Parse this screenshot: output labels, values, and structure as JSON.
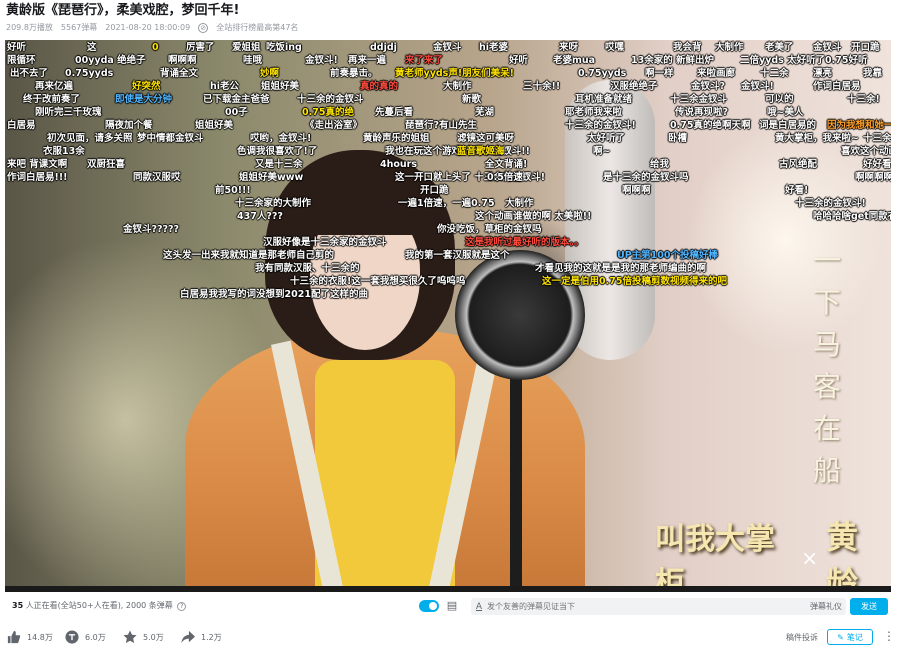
{
  "video": {
    "title": "黄龄版《琵琶行》，柔美戏腔，梦回千年!",
    "views": "209.8万播放",
    "danmaku_count": "5567弹幕",
    "date": "2021-08-20 18:00:09",
    "rank": "全站排行榜最高第47名"
  },
  "player": {
    "overlay_vertical_text": "一下马客在船",
    "logo_left": "叫我大掌柜",
    "logo_x": "×",
    "logo_right": "黄龄"
  },
  "danmaku": [
    "好听",
    "这",
    "0",
    "厉害了",
    "爱姐姐",
    "吃饭ing",
    "ddjdj",
    "金钗斗",
    "hi老婆",
    "来呀",
    "哎嘿",
    "我会背",
    "大制作",
    "老美了",
    "金钗斗",
    "开口跪",
    "限循环",
    "00yyda 绝绝子",
    "啊啊啊",
    "哇哦",
    "金钗斗!",
    "再来一遍",
    "来了来了",
    "好听",
    "老婆mua",
    "13余家的 新鲜出炉",
    "二倍yyds 太好听了",
    "0.75好听",
    "出不去了",
    "0.75yyds",
    "背诵全文",
    "妙啊",
    "前奏暴击。",
    "黄老师yyds声!朋友们美呆!",
    "0.75yyds",
    "啊一样",
    "来啦画廊",
    "十二余",
    "漂亮",
    "我靠",
    "再来亿遍",
    "好突然",
    "hi老公",
    "姐姐好美",
    "真的真的",
    "大制作",
    "三十余!!",
    "汉服绝绝子",
    "金钗斗?",
    "金钗斗!",
    "作词白居易",
    "终于改前奏了",
    "即使是大分钟",
    "已下载金主爸爸",
    "十三余的金钗斗",
    "新歌",
    "耳机准备就绪",
    "十三余金钗斗",
    "可以的",
    "十三余!",
    "刚听完三千玫瑰",
    "00子",
    "0.75真的绝",
    "先蔓后看",
    "芜湖",
    "耶老师我来啦",
    "传说再现啦?",
    "哦~美人",
    "白居易",
    "隔夜加个餐",
    "姐姐好美",
    "《走出浴室》",
    "琵琶行?有山先生",
    "十三余的金钗斗!",
    "0.75真的绝啊天啊",
    "词是白居易的",
    "因为我想和她一起先",
    "初次见面，请多关照",
    "梦中情都金钗斗",
    "哎哟，金钗斗!",
    "黄龄声乐的姐姐",
    "滤镜这可美呀",
    "太好听了",
    "卧槽",
    "黄大掌柜，我来啦~",
    "十三余的金钗斗",
    "衣服13余",
    "色调我很喜欢了!了",
    "我也在玩这个游戏 十三余金钗斗!!",
    "蓝音歌姬海",
    "啊~",
    "喜欢这个动画背景",
    "来吧 背课文啊",
    "双厨狂喜",
    "又是十三余",
    "4hours",
    "全文背诵!",
    "给我",
    "古风绝配",
    "好好看(●·.·●)",
    "作词白居易!!!",
    "同款汉服哎",
    "姐姐好美www",
    "这一开口就上头了 十三余的金钗斗!",
    "0.5倍速",
    "是十三余的金钗斗吗",
    "啊啊啊啊啊",
    "前50!!!",
    "开口跪",
    "啊啊啊",
    "好看!",
    "十三余家的大制作",
    "一遍1倍速，一遍0.75",
    "大制作",
    "十三余的金钗斗!",
    "437人???",
    "这个动画谁做的啊 太美啦!!",
    "哈哈哈啥get同款衣服了",
    "金钗斗?????",
    "你没吃饭，草柜的金钗吗",
    "汉服好像是十三余家的金钗斗",
    "这是我听过最好听的版本。。",
    "这头发一出来我就知道是那老师自己剪的",
    "我的第一套汉服就是这个",
    "UP主第100个投稿好棒",
    "我有同款汉服、十三余的",
    "才看见我的这就是是我的那老师编曲的啊",
    "十三余的衣服!这一套我想买很久了呜呜呜",
    "这一定是伯用0.75倍投稿剪数视频得来的吧",
    "白居易我我写的词没想到2021配了这样的曲"
  ],
  "danmaku_bar": {
    "online": "35",
    "online_text": "人正在看(全站50+人在看), 2000 条弹幕",
    "input_placeholder": "发个友善的弹幕见证当下",
    "etiquette": "弹幕礼仪",
    "send_label": "发送"
  },
  "actions": {
    "like": "14.8万",
    "coin": "6.0万",
    "favorite": "5.0万",
    "share": "1.2万",
    "report": "稿件投诉",
    "note": "笔记"
  }
}
